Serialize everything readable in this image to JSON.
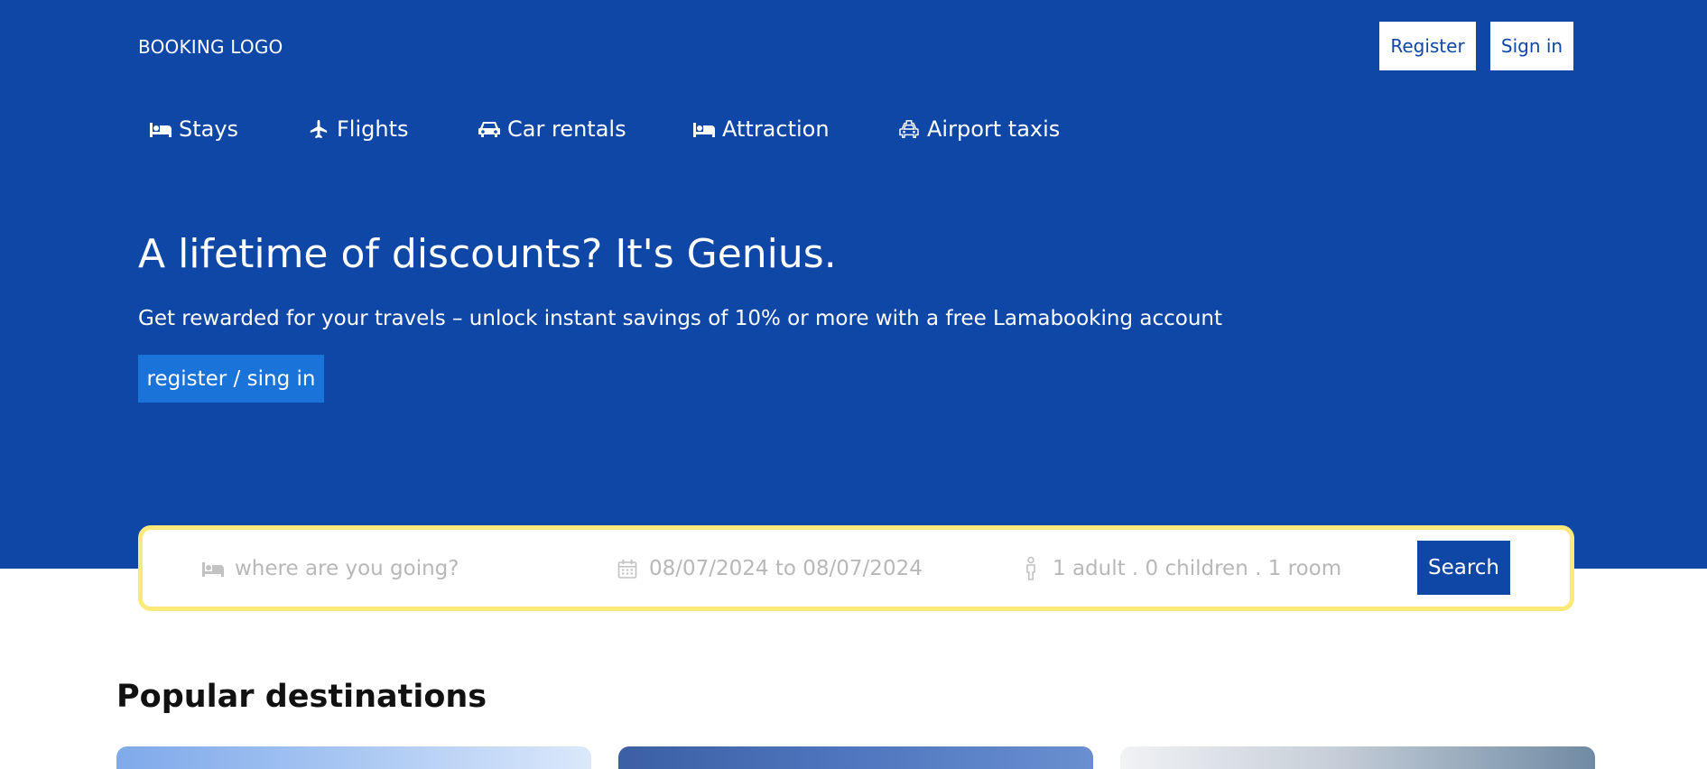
{
  "header": {
    "logo": "BOOKING LOGO",
    "register_label": "Register",
    "signin_label": "Sign in"
  },
  "nav": {
    "items": [
      {
        "label": "Stays",
        "icon": "bed-icon"
      },
      {
        "label": "Flights",
        "icon": "plane-icon"
      },
      {
        "label": "Car rentals",
        "icon": "car-icon"
      },
      {
        "label": "Attraction",
        "icon": "bed-icon"
      },
      {
        "label": "Airport taxis",
        "icon": "taxi-icon"
      }
    ]
  },
  "hero": {
    "title": "A lifetime of discounts? It's Genius.",
    "subtitle": "Get rewarded for your travels – unlock instant savings of 10% or more with a free Lamabooking account",
    "cta_label": "register / sing in"
  },
  "search": {
    "destination_placeholder": "where are you going?",
    "dates_text": "08/07/2024 to 08/07/2024",
    "guests_text": "1 adult . 0 children . 1 room",
    "button_label": "Search"
  },
  "popular": {
    "title": "Popular destinations"
  },
  "colors": {
    "brand_blue": "#0f47a6",
    "cta_blue": "#1a73d9",
    "search_border": "#fbe97a"
  }
}
